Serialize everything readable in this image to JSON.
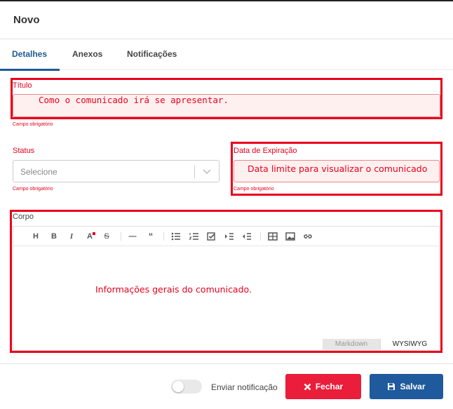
{
  "dialog": {
    "title": "Novo"
  },
  "tabs": [
    {
      "label": "Detalhes",
      "active": true
    },
    {
      "label": "Anexos",
      "active": false
    },
    {
      "label": "Notificações",
      "active": false
    }
  ],
  "fields": {
    "titulo": {
      "label": "Título",
      "hint": "Campo obrigatório",
      "annotation": "Como o comunicado irá se apresentar."
    },
    "status": {
      "label": "Status",
      "placeholder": "Selecione",
      "hint": "Campo obrigatório"
    },
    "expiracao": {
      "label": "Data de Expiração",
      "hint": "Campo obrigatório",
      "annotation": "Data limite para visualizar o comunicado"
    },
    "corpo": {
      "label": "Corpo",
      "annotation": "Informações gerais do comunicado."
    }
  },
  "editor": {
    "toolbar": [
      "heading-icon",
      "bold-icon",
      "italic-icon",
      "text-color-icon",
      "strikethrough-icon",
      "horizontal-rule-icon",
      "quote-icon",
      "bullet-list-icon",
      "numbered-list-icon",
      "task-list-icon",
      "indent-icon",
      "outdent-icon",
      "table-icon",
      "image-icon",
      "link-icon"
    ],
    "modes": {
      "markdown": "Markdown",
      "wysiwyg": "WYSIWYG",
      "active": "WYSIWYG"
    }
  },
  "footer": {
    "toggle_label": "Enviar notificação",
    "toggle_on": false,
    "close_label": "Fechar",
    "save_label": "Salvar"
  },
  "colors": {
    "primary": "#1f5a9c",
    "danger": "#ea1d3a",
    "annotation": "#e8001c"
  }
}
